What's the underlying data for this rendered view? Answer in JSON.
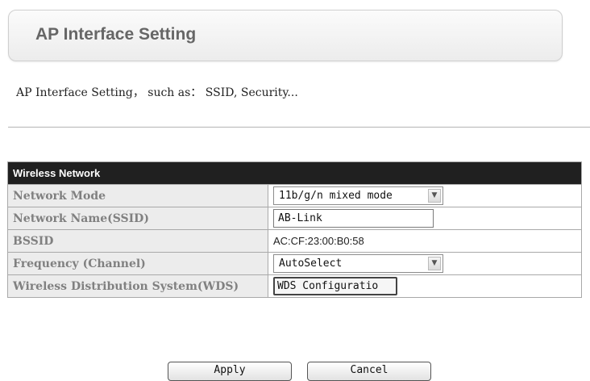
{
  "header": {
    "title": "AP Interface Setting",
    "description": "AP Interface Setting， such as： SSID, Security..."
  },
  "wireless_table": {
    "section_title": "Wireless Network",
    "rows": {
      "network_mode": {
        "label": "Network Mode",
        "selected": "11b/g/n mixed mode"
      },
      "ssid": {
        "label": "Network Name(SSID)",
        "value": "AB-Link"
      },
      "bssid": {
        "label": "BSSID",
        "value": "AC:CF:23:00:B0:58"
      },
      "channel": {
        "label": "Frequency (Channel)",
        "selected": "AutoSelect"
      },
      "wds": {
        "label": "Wireless Distribution System(WDS)",
        "button": "WDS Configuratio"
      }
    }
  },
  "actions": {
    "apply_label": "Apply",
    "cancel_label": "Cancel"
  },
  "icons": {
    "dropdown": "chevron-down-icon"
  }
}
